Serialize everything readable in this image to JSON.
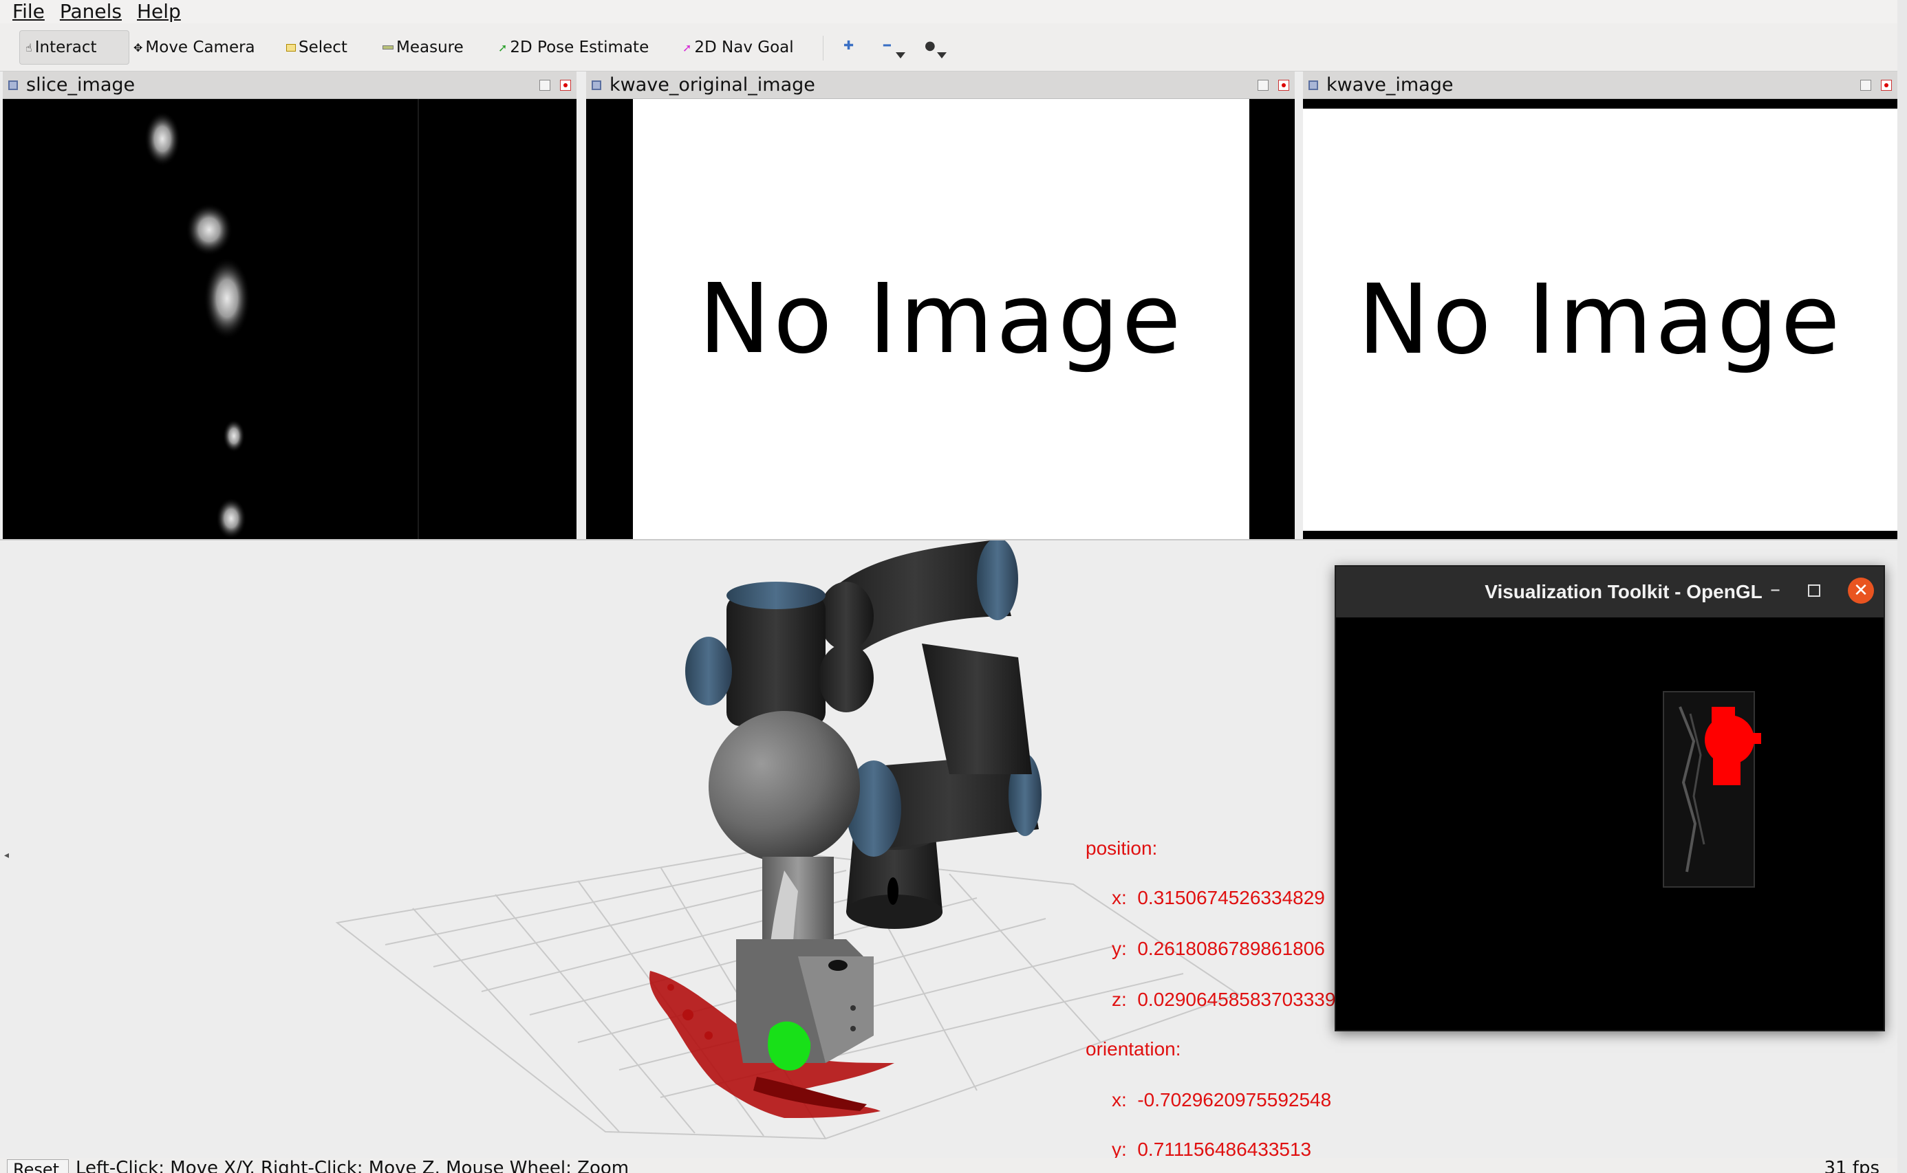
{
  "menu": {
    "file": "File",
    "panels": "Panels",
    "help": "Help"
  },
  "toolbar": {
    "interact": "Interact",
    "move_camera": "Move Camera",
    "select": "Select",
    "measure": "Measure",
    "pose_estimate": "2D Pose Estimate",
    "nav_goal": "2D Nav Goal"
  },
  "panels": {
    "slice": {
      "title": "slice_image"
    },
    "kwave_original": {
      "title": "kwave_original_image",
      "placeholder": "No Image"
    },
    "kwave": {
      "title": "kwave_image",
      "placeholder": "No Image"
    }
  },
  "pose": {
    "position_label": "position:",
    "x_label": "x:",
    "x": "0.3150674526334829",
    "y_label": "y:",
    "y": "0.2618086789861806",
    "z_label": "z:",
    "z": "0.02906458583703339",
    "orientation_label": "orientation:",
    "ox_label": "x:",
    "ox": "-0.7029620975592548",
    "oy_label": "y:",
    "oy": "0.711156486433513"
  },
  "vtk": {
    "title": "Visualization Toolkit - OpenGL"
  },
  "status": {
    "reset": "Reset",
    "hint": "Left-Click: Move X/Y. Right-Click: Move Z. Mouse Wheel: Zoom",
    "fps": "31 fps"
  },
  "colors": {
    "annotation": "#e01010",
    "vtk_close": "#e95420",
    "tool_tip": "#00d000"
  }
}
